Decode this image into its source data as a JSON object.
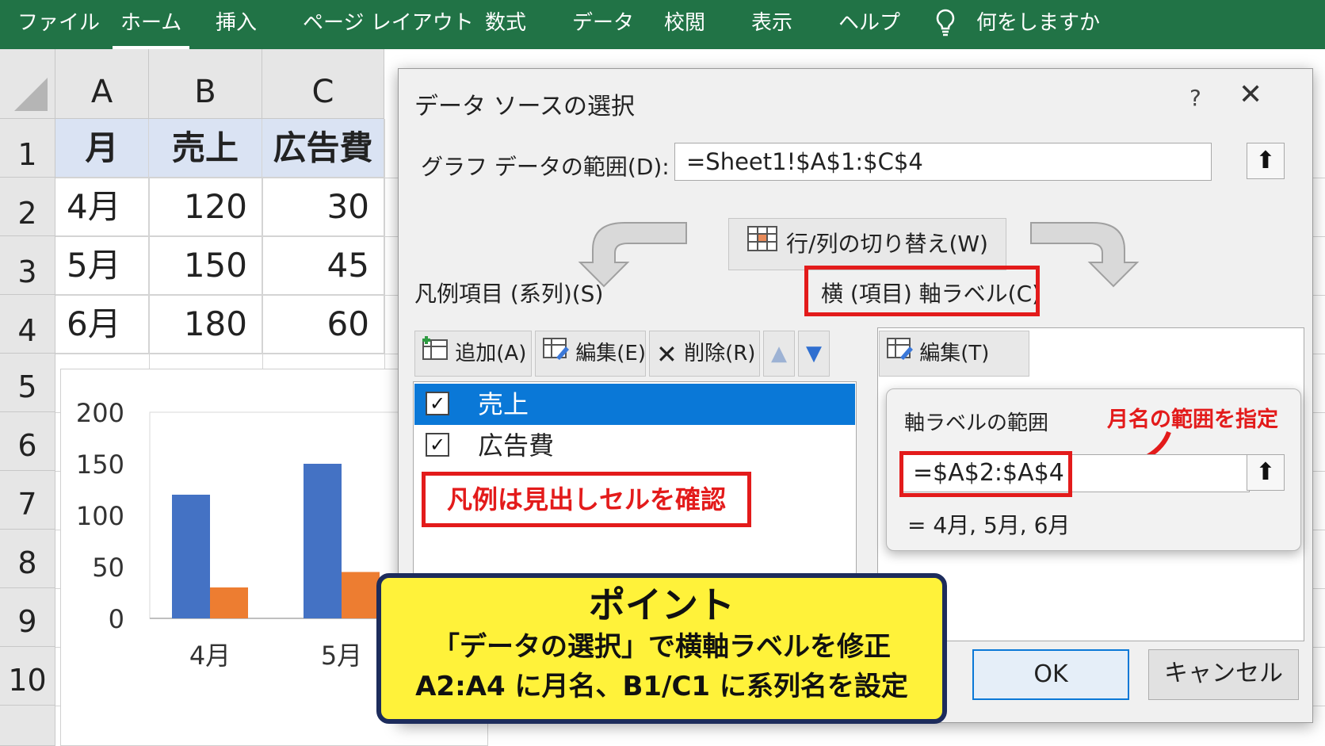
{
  "ribbon": {
    "tabs": [
      "ファイル",
      "ホーム",
      "挿入",
      "ページ レイアウト",
      "数式",
      "データ",
      "校閲",
      "表示",
      "ヘルプ"
    ],
    "search_label": "何をしますか",
    "colors": {
      "bg": "#217346",
      "text": "#ffffff"
    }
  },
  "sheet": {
    "col_headers": [
      "A",
      "B",
      "C"
    ],
    "row_headers": [
      "1",
      "2",
      "3",
      "4",
      "5",
      "6",
      "7",
      "8",
      "9",
      "10"
    ],
    "table": {
      "header": [
        "月",
        "売上",
        "広告費"
      ],
      "rows": [
        [
          "4月",
          "120",
          "30"
        ],
        [
          "5月",
          "150",
          "45"
        ],
        [
          "6月",
          "180",
          "60"
        ]
      ]
    }
  },
  "chart_data": {
    "type": "bar",
    "categories": [
      "4月",
      "5月"
    ],
    "series": [
      {
        "values": [
          120,
          150
        ],
        "color": "#4472c4"
      },
      {
        "values": [
          30,
          45
        ],
        "color": "#ed7d31"
      }
    ],
    "y_ticks": [
      "200",
      "150",
      "100",
      "50",
      "0"
    ],
    "ylim": [
      0,
      200
    ],
    "grid": false
  },
  "dialog": {
    "title": "データ ソースの選択",
    "help": "?",
    "close": "✕",
    "range_label": "グラフ データの範囲(D):",
    "range_value": "=Sheet1!$A$1:$C$4",
    "switch_label": "行/列の切り替え(W)",
    "legend_label": "凡例項目 (系列)(S)",
    "axis_label": "横 (項目) 軸ラベル(C)",
    "add_label": "追加(A)",
    "edit_label": "編集(E)",
    "delete_label": "削除(R)",
    "axis_edit_label": "編集(T)",
    "series": [
      {
        "name": "売上",
        "checked": true,
        "selected": true
      },
      {
        "name": "広告費",
        "checked": true,
        "selected": false
      }
    ],
    "ok_label": "OK",
    "cancel_label": "キャンセル"
  },
  "popup": {
    "title": "軸ラベルの範囲",
    "range_value": "=$A$2:$A$4",
    "preview": "= 4月, 5月, 6月"
  },
  "annotations": {
    "legend_note": "凡例は見出しセルを確認",
    "month_note": "月名の範囲を指定",
    "point_title": "ポイント",
    "point_line1": "「データの選択」で横軸ラベルを修正",
    "point_line2": "A2:A4 に月名、B1/C1 に系列名を設定",
    "accent_red": "#e31b1b",
    "note_bg": "#fff23a",
    "note_border": "#1d2c5c"
  }
}
